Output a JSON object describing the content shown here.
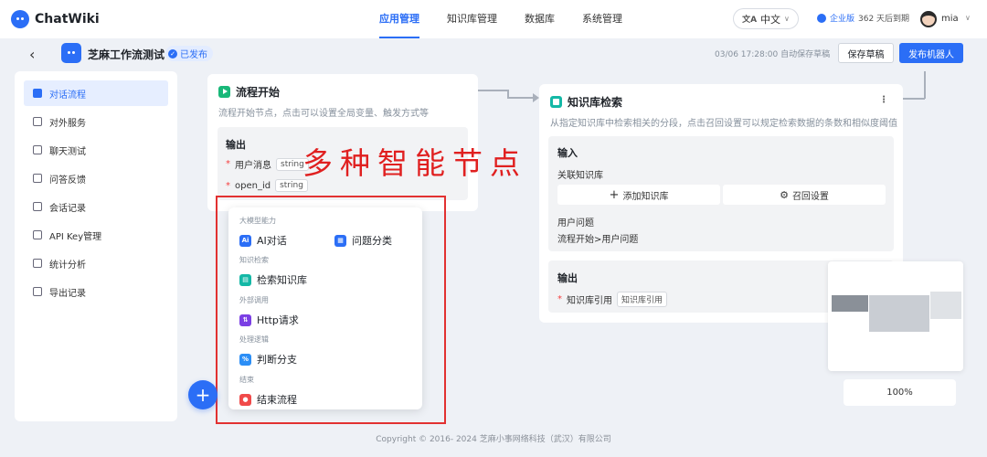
{
  "app": {
    "name": "ChatWiki"
  },
  "nav": {
    "tabs": [
      "应用管理",
      "知识库管理",
      "数据库",
      "系统管理"
    ],
    "active_index": 0,
    "lang": "中文",
    "edition": "企业版",
    "expiry": "362 天后到期",
    "user": "mia"
  },
  "header": {
    "title": "芝麻工作流测试",
    "status": "已发布",
    "autosave": "03/06 17:28:00 自动保存草稿",
    "save_label": "保存草稿",
    "publish_label": "发布机器人"
  },
  "sidebar": {
    "items": [
      "对话流程",
      "对外服务",
      "聊天测试",
      "问答反馈",
      "会话记录",
      "API Key管理",
      "统计分析",
      "导出记录"
    ],
    "active_index": 0
  },
  "start_node": {
    "title": "流程开始",
    "desc": "流程开始节点，点击可以设置全局变量、触发方式等",
    "output_title": "输出",
    "fields": [
      {
        "name": "用户消息",
        "type": "string"
      },
      {
        "name": "open_id",
        "type": "string"
      }
    ]
  },
  "kb_node": {
    "title": "知识库检索",
    "desc": "从指定知识库中检索相关的分段，点击召回设置可以规定检索数据的条数和相似度阈值",
    "input_title": "输入",
    "assoc_label": "关联知识库",
    "add_btn": "添加知识库",
    "recall_btn": "召回设置",
    "question_label": "用户问题",
    "question_value": "流程开始>用户问题",
    "output_title": "输出",
    "output_field": "知识库引用",
    "output_tag": "知识库引用"
  },
  "menu": {
    "groups": [
      "大模型能力",
      "知识检索",
      "外部调用",
      "处理逻辑",
      "结束"
    ],
    "items": [
      {
        "label": "AI对话",
        "icon": "ai-icon"
      },
      {
        "label": "问题分类",
        "icon": "category-icon"
      },
      {
        "label": "检索知识库",
        "icon": "knowledge-icon"
      },
      {
        "label": "Http请求",
        "icon": "http-icon"
      },
      {
        "label": "判断分支",
        "icon": "branch-icon"
      },
      {
        "label": "结束流程",
        "icon": "end-icon"
      }
    ]
  },
  "annotation": "多种智能节点",
  "zoom": "100%",
  "footer": "Copyright © 2016- 2024 芝麻小事网络科技（武汉）有限公司",
  "colors": {
    "primary": "#2b6ef6",
    "annotation": "#e02020",
    "background": "#eef1f6"
  }
}
